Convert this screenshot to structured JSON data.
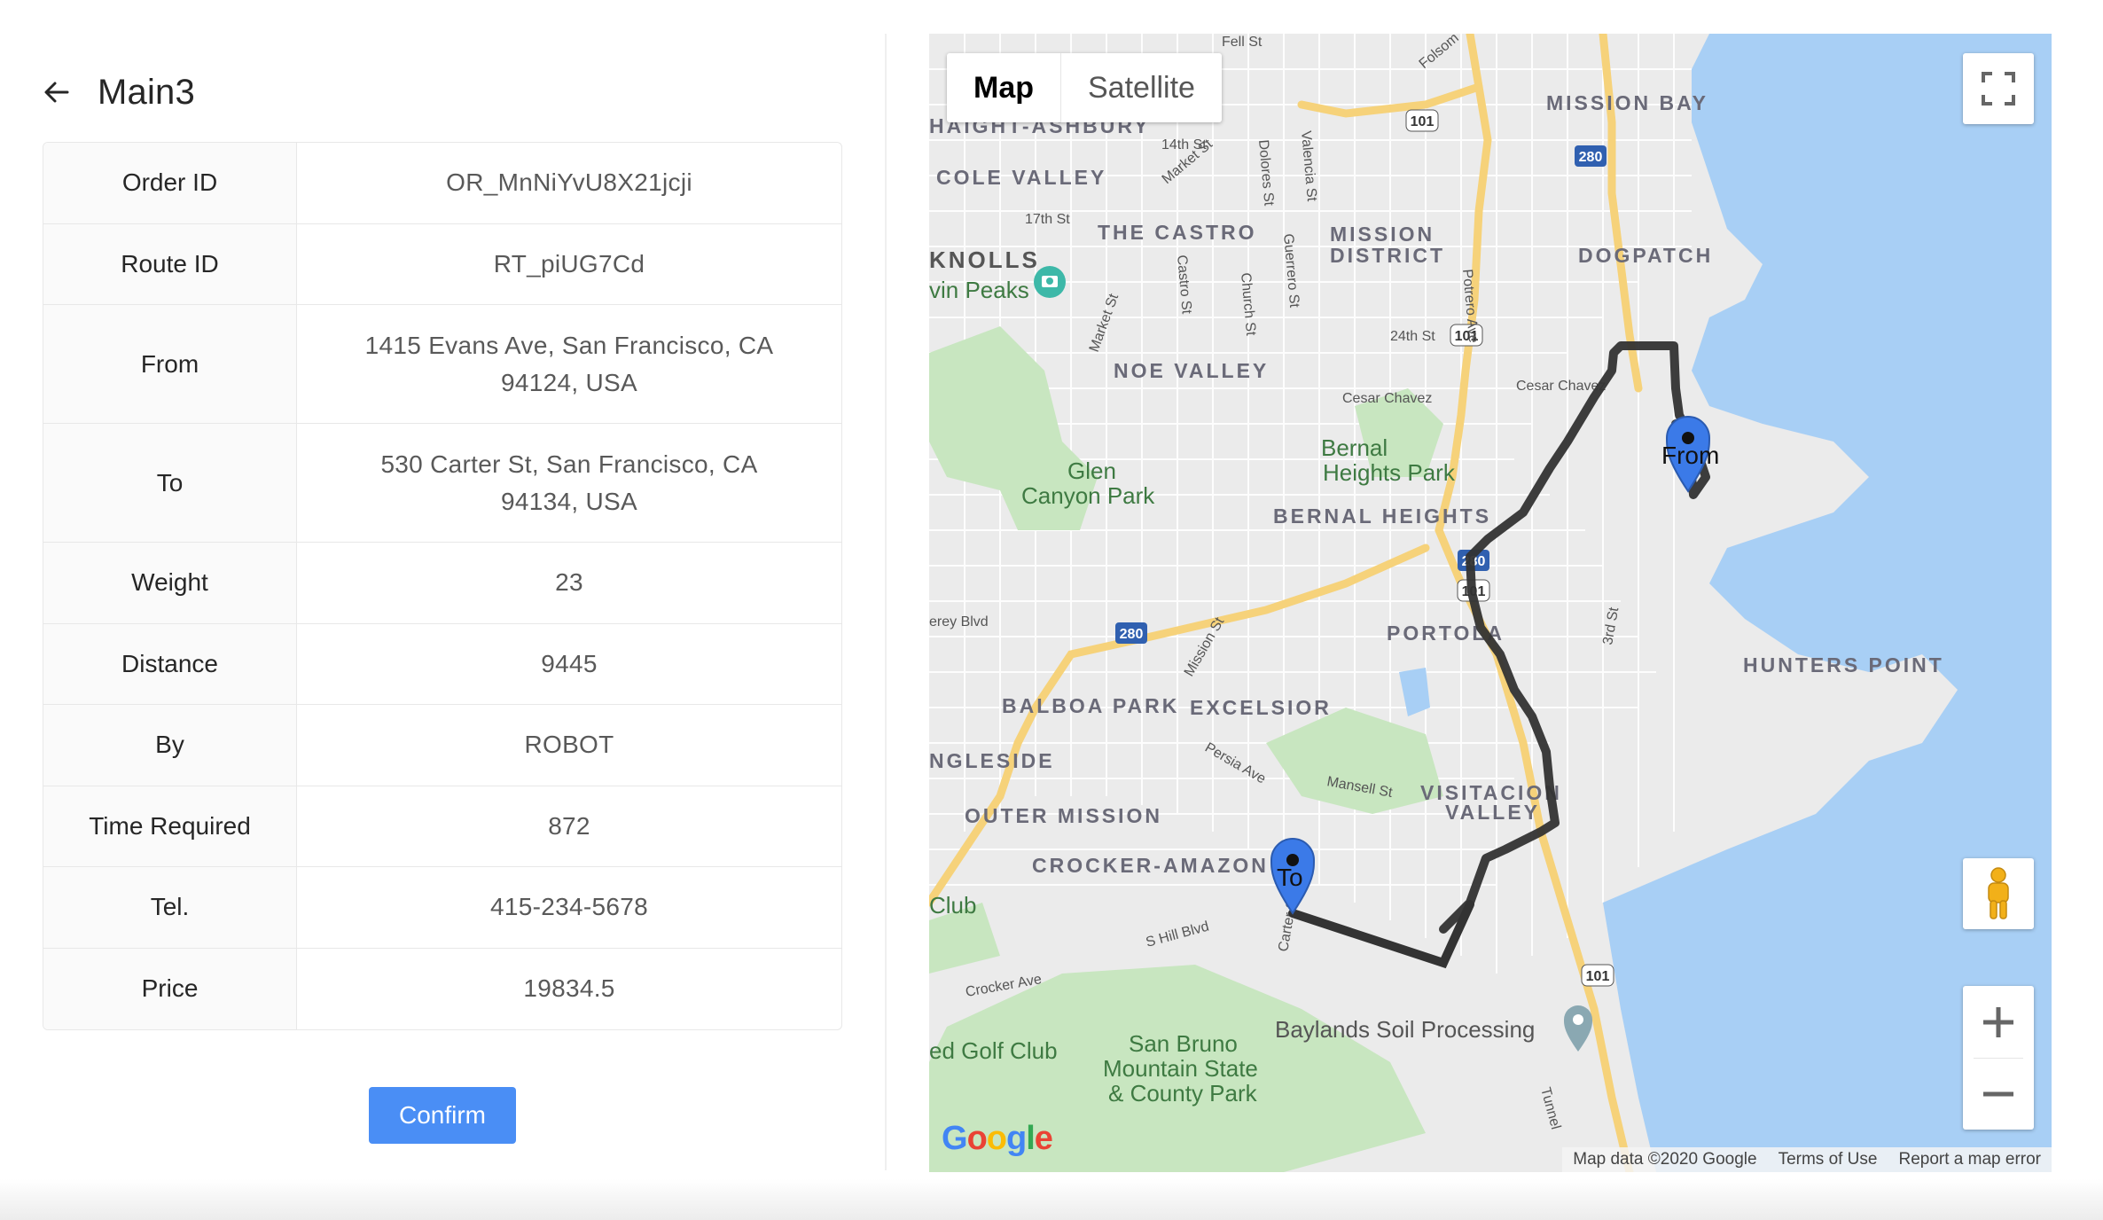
{
  "page": {
    "title": "Main3"
  },
  "details": {
    "rows": [
      {
        "label": "Order ID",
        "value": "OR_MnNiYvU8X21jcji"
      },
      {
        "label": "Route ID",
        "value": "RT_piUG7Cd"
      },
      {
        "label": "From",
        "value": "1415 Evans Ave, San Francisco, CA 94124, USA"
      },
      {
        "label": "To",
        "value": "530 Carter St, San Francisco, CA 94134, USA"
      },
      {
        "label": "Weight",
        "value": "23"
      },
      {
        "label": "Distance",
        "value": "9445"
      },
      {
        "label": "By",
        "value": "ROBOT"
      },
      {
        "label": "Time Required",
        "value": "872"
      },
      {
        "label": "Tel.",
        "value": "415-234-5678"
      },
      {
        "label": "Price",
        "value": "19834.5"
      }
    ]
  },
  "actions": {
    "confirm_label": "Confirm"
  },
  "map": {
    "type_map": "Map",
    "type_satellite": "Satellite",
    "marker_from": "From",
    "marker_to": "To",
    "attribution": {
      "data": "Map data ©2020 Google",
      "terms": "Terms of Use",
      "report": "Report a map error"
    },
    "logo": "Google",
    "district_labels": [
      "MISSION BAY",
      "HAIGHT-ASHBURY",
      "COLE VALLEY",
      "THE CASTRO",
      "MISSION DISTRICT",
      "DOGPATCH",
      "NOE VALLEY",
      "BERNAL HEIGHTS",
      "PORTOLA",
      "HUNTERS POINT",
      "BALBOA PARK",
      "EXCELSIOR",
      "NGLESIDE",
      "OUTER MISSION",
      "VISITACION VALLEY",
      "CROCKER-AMAZON"
    ],
    "place_labels": [
      "KNOLLS",
      "vin Peaks",
      "Glen Canyon Park",
      "Bernal Heights Park",
      "San Bruno Mountain State & County Park",
      "Baylands Soil Processing",
      "ed Golf Club",
      "Club"
    ],
    "street_labels": [
      "Fell St",
      "Folsom",
      "14th St",
      "17th St",
      "Market St",
      "Dolores St",
      "Valencia St",
      "Castro St",
      "Church St",
      "Guerrero St",
      "Potrero Ave",
      "24th St",
      "Cesar Chavez",
      "Mission St",
      "Persia Ave",
      "Mansell St",
      "3rd St",
      "S Hill Blvd",
      "Crocker Ave",
      "Carter St",
      "Tunnel"
    ],
    "highway_shields": [
      "101",
      "280"
    ],
    "colors": {
      "water": "#a8cff5",
      "route": "#333333",
      "marker": "#3b7ae8",
      "highway": "#f6d27a",
      "park": "#c8e6c0"
    }
  }
}
